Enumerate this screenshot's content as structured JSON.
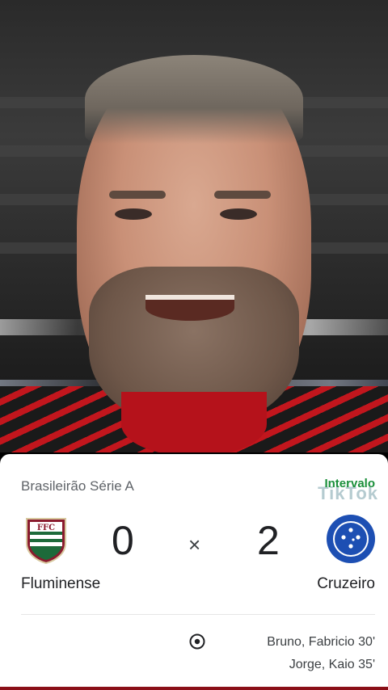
{
  "match": {
    "league": "Brasileirão Série A",
    "status": "Intervalo",
    "home": {
      "name": "Fluminense",
      "score": "0",
      "crest_icon": "fluminense-crest-icon"
    },
    "separator": "×",
    "away": {
      "name": "Cruzeiro",
      "score": "2",
      "crest_icon": "cruzeiro-crest-icon"
    },
    "goal_icon": "soccer-ball-icon",
    "scorers": [
      "Bruno, Fabricio 30'",
      "Jorge, Kaio 35'"
    ]
  },
  "watermark": {
    "brand": "TikTok"
  },
  "colors": {
    "status_green": "#1a8f3a",
    "shirt_red": "#c2161d",
    "card_bg": "#ffffff"
  }
}
